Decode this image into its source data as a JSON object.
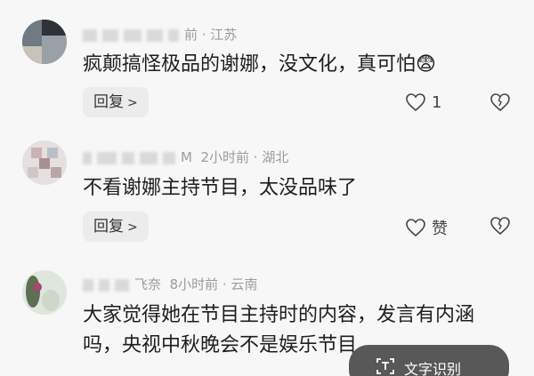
{
  "comments": [
    {
      "author": "",
      "meta": "前 · 江苏",
      "text": "疯颠搞怪极品的谢娜，没文化，真可怕😨",
      "reply_label": "回复",
      "like_count": "1"
    },
    {
      "author": "M",
      "meta": "2小时前 · 湖北",
      "text": "不看谢娜主持节目，太没品味了",
      "reply_label": "回复",
      "like_count": "赞"
    },
    {
      "author": "飞奈",
      "meta": "8小时前 · 云南",
      "text": "大家觉得她在节目主持时的内容，发言有内涵吗，央视中秋晚会不是娱乐节目"
    }
  ],
  "ocr_button": {
    "label": "文字识别"
  },
  "icons": {
    "like": "heart-outline-icon",
    "dislike": "broken-heart-icon",
    "reply_chevron": "chevron-right-icon",
    "ocr": "text-scan-icon"
  }
}
